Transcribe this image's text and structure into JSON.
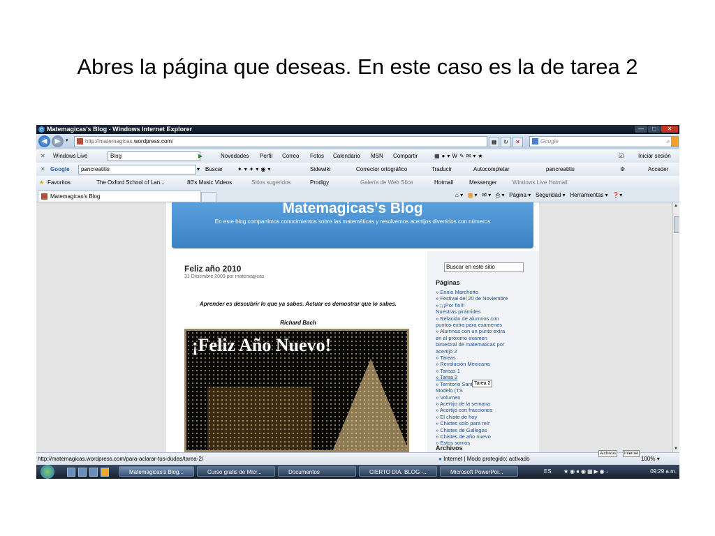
{
  "slide": {
    "title": "Abres la página que deseas. En este caso es la de tarea 2"
  },
  "window": {
    "title": "Matemagicas's Blog - Windows Internet Explorer"
  },
  "address": {
    "prefix": "http://matemagicas.",
    "host": "wordpress.com",
    "suffix": "/",
    "search_placeholder": "Google"
  },
  "toolbar_live": {
    "brand": "Windows Live",
    "search_value": "Bing",
    "items": [
      "Novedades",
      "Perfil",
      "Correo",
      "Fotos",
      "Calendario",
      "MSN",
      "Compartir"
    ],
    "signin": "Iniciar sesión"
  },
  "toolbar_google": {
    "brand": "Google",
    "search_value": "pancreatitis",
    "items": [
      "Buscar",
      "Sidewiki",
      "Corrector ortográfico",
      "Traducir",
      "Autocompletar",
      "pancreatitis"
    ],
    "signin": "Acceder"
  },
  "favorites": {
    "label": "Favoritos",
    "items": [
      "The Oxford School of Lan...",
      "80's Music Videos",
      "Sitios sugeridos",
      "Prodigy",
      "Galería de Web Slice",
      "Hotmail",
      "Messenger",
      "Windows Live Hotmail"
    ]
  },
  "tab": {
    "label": "Matemagicas's Blog"
  },
  "commandbar": {
    "items": [
      "Página",
      "Seguridad",
      "Herramientas"
    ]
  },
  "blog": {
    "title": "Matemagicas's Blog",
    "description": "En este blog compartimos conocimientos sobre las matemáticas y resolvemos acertijos divertidos con números",
    "post_title": "Feliz año 2010",
    "post_meta": "31 Diciembre 2009 por matemagicas",
    "quote": "Aprender es descubrir lo que ya sabes. Actuar  es demostrar que lo sabes.",
    "quote_author": "Richard Bach",
    "image_caption": "¡Feliz Año Nuevo!"
  },
  "sidebar": {
    "search_value": "Buscar en este sitio",
    "pages_heading": "Páginas",
    "pages": [
      "» Ennio Marchetto",
      "» Festival del 20 de Noviembre",
      "   » ¡¡¡Por fin!!!",
      "   Nuestras pirámides",
      "» Relación de alumnos con",
      "puntos extra para examenes",
      "   » Alumnos con un punto extra",
      "   en el próximo examen",
      "   bimestral de matematicas por",
      "   acertijo 2",
      "» Tareas",
      "   » Revolución Mexicana",
      "   » Tareas 1",
      "   » Tarea 2",
      "» Territorio Santos",
      "Modelo (TS",
      "» Volumen",
      "» Acertijo de la semana",
      "   » Acertijo con fracciones",
      "» El chiste de hoy",
      "   » Chistes solo para reír",
      "   » Chistes de Gallegos",
      "   » Chistes de año nuevo",
      "» Estos somos"
    ],
    "archive_heading": "Archivos",
    "tooltip": "Tarea 2"
  },
  "status": {
    "url": "http://matemagicas.wordpress.com/para-aclarar-tus-dudas/tarea-2/",
    "zone": "Internet | Modo protegido: activado",
    "zoom": "100%",
    "tip_archivos": "Archivos",
    "tip_internet": "Internet"
  },
  "taskbar": {
    "buttons": [
      "Matemagicas's Blog...",
      "Curso gratis de Micr...",
      "Documentos",
      "CIERTO DIA. BLOG -...",
      "Microsoft PowerPoi..."
    ],
    "lang": "ES",
    "time": "09:29 a.m."
  }
}
